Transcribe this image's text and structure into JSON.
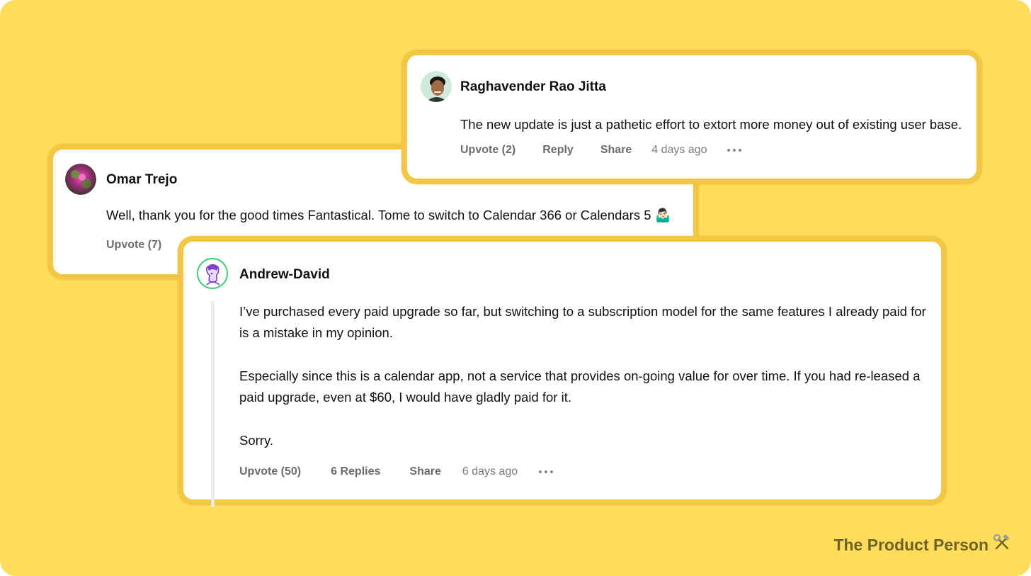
{
  "comments": {
    "omar": {
      "author": "Omar Trejo",
      "text": "Well, thank you for the good times Fantastical. Tome to switch to Calendar 366 or Calendars 5 🤷🏻‍♂️",
      "upvote": "Upvote (7)"
    },
    "raghav": {
      "author": "Raghavender Rao Jitta",
      "text": "The new update is just a pathetic effort to extort more money out of existing user base.",
      "upvote": "Upvote (2)",
      "reply": "Reply",
      "share": "Share",
      "time": "4 days ago"
    },
    "andrew": {
      "author": "Andrew-David",
      "paragraphs": [
        "I’ve purchased every paid upgrade so far, but switching to a subscription model for the same features I already paid for is a mistake in my opinion.",
        "Especially since this is a calendar app, not a service that provides on-going value for over time. If you had re-leased a paid upgrade, even at $60, I would have gladly paid for it.",
        "Sorry."
      ],
      "upvote": "Upvote (50)",
      "replies": "6 Replies",
      "share": "Share",
      "time": "6 days ago"
    }
  },
  "watermark": {
    "text": "The Product Person",
    "icon": "hammer-wrench-icon"
  },
  "colors": {
    "background": "#ffdd5a",
    "card_border": "#f2c744"
  }
}
